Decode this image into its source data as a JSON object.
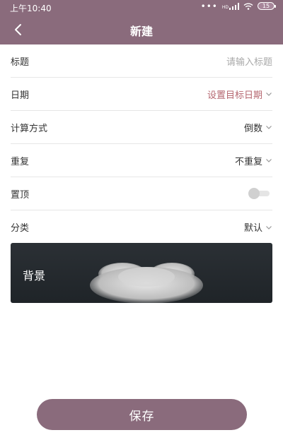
{
  "status_bar": {
    "time": "上午10:40",
    "signal_text": "HD",
    "battery": "15"
  },
  "nav": {
    "title": "新建"
  },
  "form": {
    "rows": [
      {
        "label": "标题",
        "value": "请输入标题"
      },
      {
        "label": "日期",
        "value": "设置目标日期"
      },
      {
        "label": "计算方式",
        "value": "倒数"
      },
      {
        "label": "重复",
        "value": "不重复"
      },
      {
        "label": "置顶",
        "toggle_on": false
      },
      {
        "label": "分类",
        "value": "默认"
      }
    ]
  },
  "background": {
    "label": "背景"
  },
  "actions": {
    "save_label": "保存"
  },
  "colors": {
    "primary": "#8a6b7c",
    "accent_text": "#b5666f",
    "placeholder": "#a9a9a9"
  }
}
